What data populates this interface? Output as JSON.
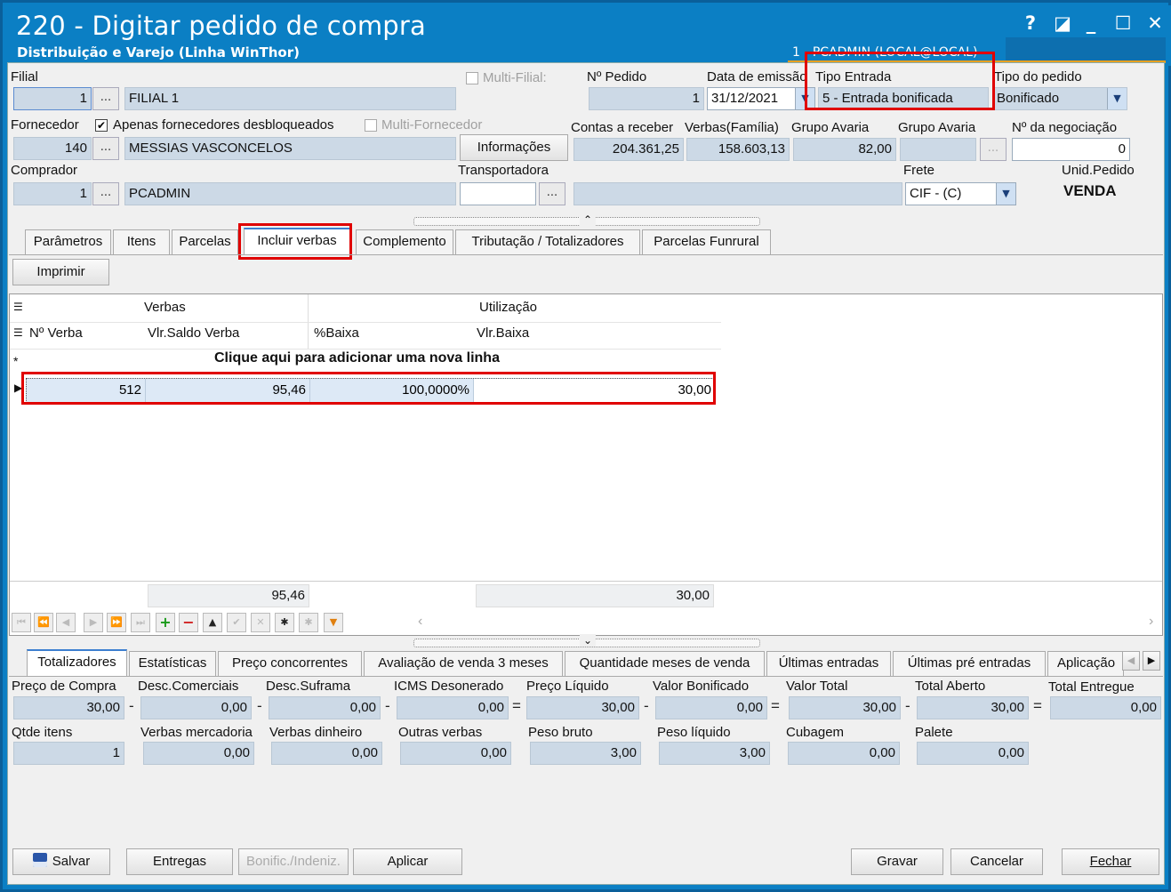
{
  "window": {
    "title": "220 - Digitar pedido de compra",
    "subtitle": "Distribuição e Varejo (Linha WinThor)",
    "user_info": "1 - PCADMIN (LOCAL@LOCAL)",
    "controls": [
      "?",
      "◪",
      "_",
      "☐",
      "✕"
    ]
  },
  "header": {
    "filial_label": "Filial",
    "filial_code": "1",
    "filial_name": "FILIAL 1",
    "multi_filial_label": "Multi-Filial:",
    "pedido_label": "Nº Pedido",
    "pedido_value": "1",
    "data_emissao_label": "Data de emissão",
    "data_emissao_value": "31/12/2021",
    "tipo_entrada_label": "Tipo Entrada",
    "tipo_entrada_value": "5 - Entrada bonificada",
    "tipo_pedido_label": "Tipo do pedido",
    "tipo_pedido_value": "Bonificado",
    "fornecedor_label": "Fornecedor",
    "apenas_desbloq_label": "Apenas fornecedores desbloqueados",
    "apenas_desbloq_checked": "✔",
    "multi_fornecedor_label": "Multi-Fornecedor",
    "fornecedor_code": "140",
    "fornecedor_name": "MESSIAS VASCONCELOS",
    "informacoes_label": "Informações",
    "contas_receber_label": "Contas a receber",
    "contas_receber_value": "204.361,25",
    "verbas_familia_label": "Verbas(Família)",
    "verbas_familia_value": "158.603,13",
    "grupo_avaria1_label": "Grupo Avaria",
    "grupo_avaria1_value": "82,00",
    "grupo_avaria2_label": "Grupo Avaria",
    "negociacao_label": "Nº da negociação",
    "negociacao_value": "0",
    "comprador_label": "Comprador",
    "comprador_code": "1",
    "comprador_name": "PCADMIN",
    "transportadora_label": "Transportadora",
    "frete_label": "Frete",
    "frete_value": "CIF - (C)",
    "unid_pedido_label": "Unid.Pedido",
    "unid_pedido_value": "VENDA",
    "ellipsis": "..."
  },
  "tabs_top": [
    "Parâmetros",
    "Itens",
    "Parcelas",
    "Incluir verbas",
    "Complemento",
    "Tributação / Totalizadores",
    "Parcelas Funrural"
  ],
  "imprimir_label": "Imprimir",
  "grid": {
    "group_verbas": "Verbas",
    "group_utilizacao": "Utilização",
    "col_nverba": "Nº Verba",
    "col_vlsaldo": "Vlr.Saldo Verba",
    "col_baixa_pct": "%Baixa",
    "col_vlbaixa": "Vlr.Baixa",
    "new_row_hint": "Clique aqui para adicionar uma nova linha",
    "rows": [
      {
        "nverba": "512",
        "vlsaldo": "95,46",
        "baixa_pct": "100,0000%",
        "vlbaixa": "30,00"
      }
    ],
    "footer_vlsaldo": "95,46",
    "footer_vlbaixa": "30,00"
  },
  "tabs_bottom": [
    "Totalizadores",
    "Estatísticas",
    "Preço concorrentes",
    "Avaliação de venda 3 meses",
    "Quantidade meses de venda",
    "Últimas entradas",
    "Últimas pré entradas",
    "Aplicação"
  ],
  "totals": {
    "preco_compra_label": "Preço de Compra",
    "preco_compra": "30,00",
    "desc_comerciais_label": "Desc.Comerciais",
    "desc_comerciais": "0,00",
    "desc_suframa_label": "Desc.Suframa",
    "desc_suframa": "0,00",
    "icms_label": "ICMS Desonerado",
    "icms": "0,00",
    "preco_liquido_label": "Preço Líquido",
    "preco_liquido": "30,00",
    "valor_bonificado_label": "Valor Bonificado",
    "valor_bonificado": "0,00",
    "valor_total_label": "Valor Total",
    "valor_total": "30,00",
    "total_aberto_label": "Total Aberto",
    "total_aberto": "30,00",
    "total_entregue_label": "Total Entregue",
    "total_entregue": "0,00",
    "qtde_itens_label": "Qtde itens",
    "qtde_itens": "1",
    "verbas_mercadoria_label": "Verbas mercadoria",
    "verbas_mercadoria": "0,00",
    "verbas_dinheiro_label": "Verbas dinheiro",
    "verbas_dinheiro": "0,00",
    "outras_verbas_label": "Outras verbas",
    "outras_verbas": "0,00",
    "peso_bruto_label": "Peso bruto",
    "peso_bruto": "3,00",
    "peso_liquido_label": "Peso líquido",
    "peso_liquido": "3,00",
    "cubagem_label": "Cubagem",
    "cubagem": "0,00",
    "palete_label": "Palete",
    "palete": "0,00",
    "minus": "-",
    "equals": "="
  },
  "footer_buttons": {
    "salvar": "Salvar",
    "entregas": "Entregas",
    "bonific": "Bonific./Indeniz.",
    "aplicar": "Aplicar",
    "gravar": "Gravar",
    "cancelar": "Cancelar",
    "fechar": "Fechar"
  },
  "colors": {
    "title_bar": "#0b7fc4",
    "highlight_box": "#e00000",
    "field_bg": "#ccd9e6"
  }
}
